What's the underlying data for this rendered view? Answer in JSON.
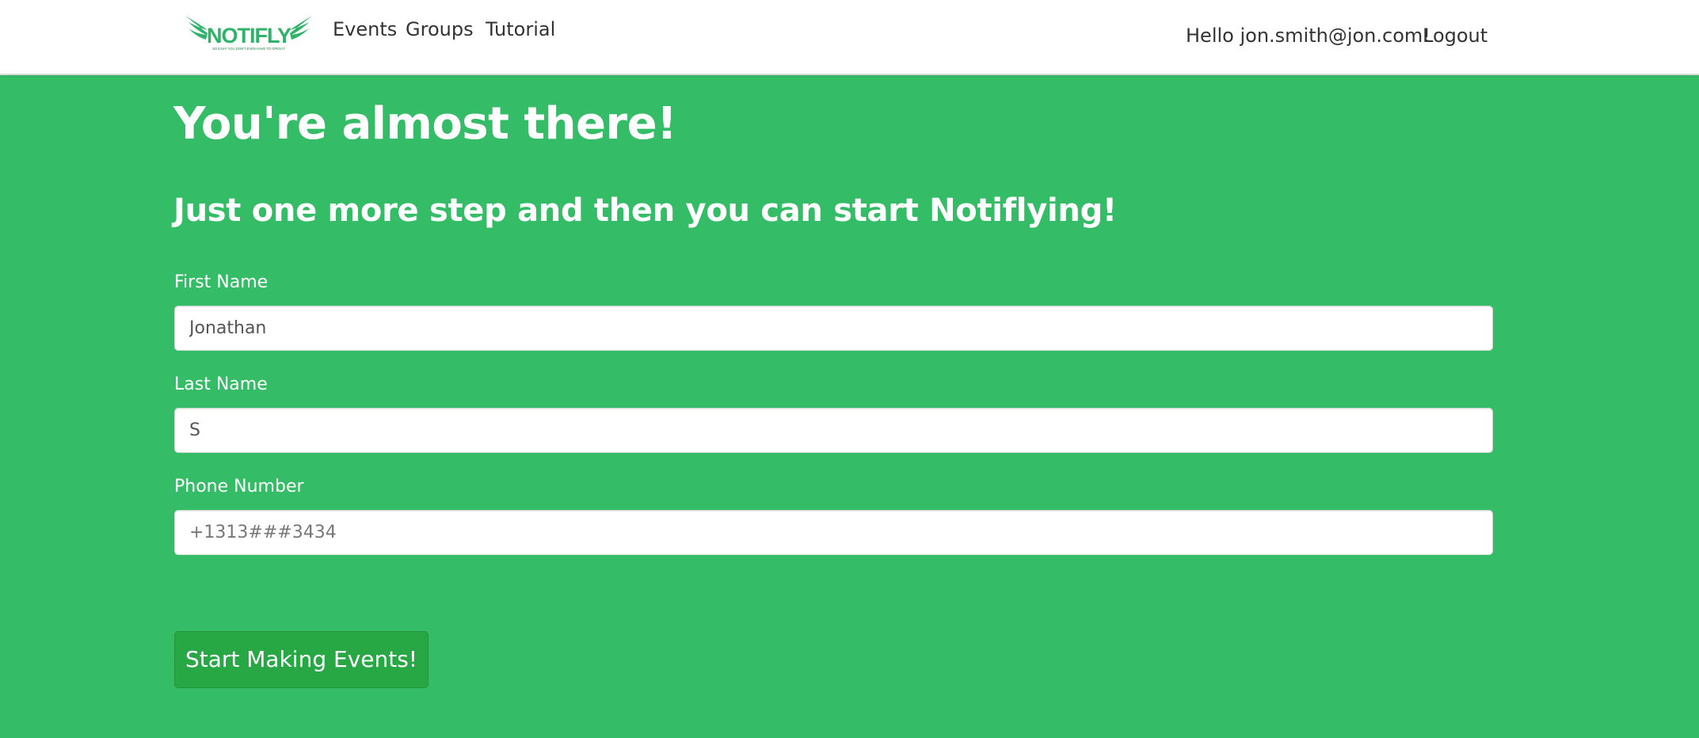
{
  "colors": {
    "page_background": "#35bc66",
    "navbar_background": "#ffffff",
    "button_background": "#28a745",
    "logo_green": "#2fb36a"
  },
  "navbar": {
    "logo": {
      "text": "NOTIFLY",
      "tagline": "SO EASY YOU DON'T EVEN HAVE TO OPEN IT"
    },
    "links": [
      {
        "label": "Events"
      },
      {
        "label": "Groups"
      },
      {
        "label": "Tutorial"
      }
    ],
    "greeting": "Hello jon.smith@jon.com!",
    "logout_label": "Logout"
  },
  "main": {
    "heading": "You're almost there!",
    "subheading": "Just one more step and then you can start Notiflying!",
    "form": {
      "first_name": {
        "label": "First Name",
        "value": "Jonathan",
        "placeholder": ""
      },
      "last_name": {
        "label": "Last Name",
        "value": "S",
        "placeholder": ""
      },
      "phone": {
        "label": "Phone Number",
        "value": "",
        "placeholder": "+1313###3434"
      },
      "submit_label": "Start Making Events!"
    }
  }
}
